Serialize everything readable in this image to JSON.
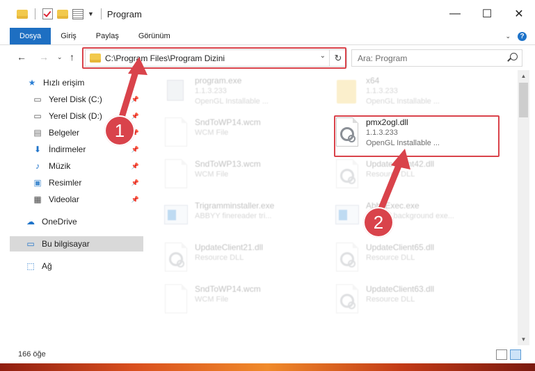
{
  "window": {
    "title": "Program",
    "minimize": "—",
    "maximize": "☐",
    "close": "✕"
  },
  "ribbon": {
    "tabs": [
      {
        "label": "Dosya",
        "active": true
      },
      {
        "label": "Giriş"
      },
      {
        "label": "Paylaş"
      },
      {
        "label": "Görünüm"
      }
    ],
    "help": "?"
  },
  "address": {
    "path": "C:\\Program Files\\Program Dizini",
    "search_placeholder": "Ara: Program"
  },
  "nav": {
    "items": [
      {
        "label": "Hızlı erişim",
        "icon": "star-icon",
        "pinned": false
      },
      {
        "label": "Yerel Disk (C:)",
        "icon": "drive-icon",
        "pinned": true
      },
      {
        "label": "Yerel Disk (D:)",
        "icon": "drive-icon",
        "pinned": true
      },
      {
        "label": "Belgeler",
        "icon": "documents-icon",
        "pinned": true
      },
      {
        "label": "İndirmeler",
        "icon": "download-icon",
        "pinned": true
      },
      {
        "label": "Müzik",
        "icon": "music-icon",
        "pinned": true
      },
      {
        "label": "Resimler",
        "icon": "pictures-icon",
        "pinned": true
      },
      {
        "label": "Videolar",
        "icon": "video-icon",
        "pinned": true
      },
      {
        "label": "OneDrive",
        "icon": "cloud-icon",
        "pinned": false
      },
      {
        "label": "Bu bilgisayar",
        "icon": "computer-icon",
        "pinned": false,
        "selected": true
      },
      {
        "label": "Ağ",
        "icon": "network-icon",
        "pinned": false
      }
    ]
  },
  "files": [
    {
      "name": "program.exe",
      "line2": "1.1.3.233",
      "line3": "OpenGL Installable ...",
      "icon": "exe-icon",
      "faded": true
    },
    {
      "name": "x64",
      "line2": "1.1.3.233",
      "line3": "OpenGL Installable ...",
      "icon": "folder-icon",
      "faded": true
    },
    {
      "name": "SndToWP14.wcm",
      "line2": "WCM File",
      "line3": "",
      "icon": "file-icon",
      "faded": true
    },
    {
      "name": "pmx2ogl.dll",
      "line2": "1.1.3.233",
      "line3": "OpenGL Installable ...",
      "icon": "dll-icon",
      "faded": false
    },
    {
      "name": "SndToWP13.wcm",
      "line2": "WCM File",
      "line3": "",
      "icon": "file-icon",
      "faded": true
    },
    {
      "name": "UpdateClient42.dll",
      "line2": "Resource DLL",
      "line3": "",
      "icon": "dll-icon",
      "faded": true
    },
    {
      "name": "Trigramminstaller.exe",
      "line2": "ABBYY finereader tri...",
      "line3": "",
      "icon": "app-icon",
      "faded": true
    },
    {
      "name": "AbbyExec.exe",
      "line2": "ABBYY background exe...",
      "line3": "",
      "icon": "app-icon",
      "faded": true
    },
    {
      "name": "UpdateClient21.dll",
      "line2": "Resource DLL",
      "line3": "",
      "icon": "dll-icon",
      "faded": true
    },
    {
      "name": "UpdateClient65.dll",
      "line2": "Resource DLL",
      "line3": "",
      "icon": "dll-icon",
      "faded": true
    },
    {
      "name": "SndToWP14.wcm",
      "line2": "WCM File",
      "line3": "",
      "icon": "file-icon",
      "faded": true
    },
    {
      "name": "UpdateClient63.dll",
      "line2": "Resource DLL",
      "line3": "",
      "icon": "dll-icon",
      "faded": true
    }
  ],
  "status": {
    "count": "166 öğe"
  },
  "annotations": {
    "step1": "1",
    "step2": "2",
    "color": "#d9434b"
  }
}
